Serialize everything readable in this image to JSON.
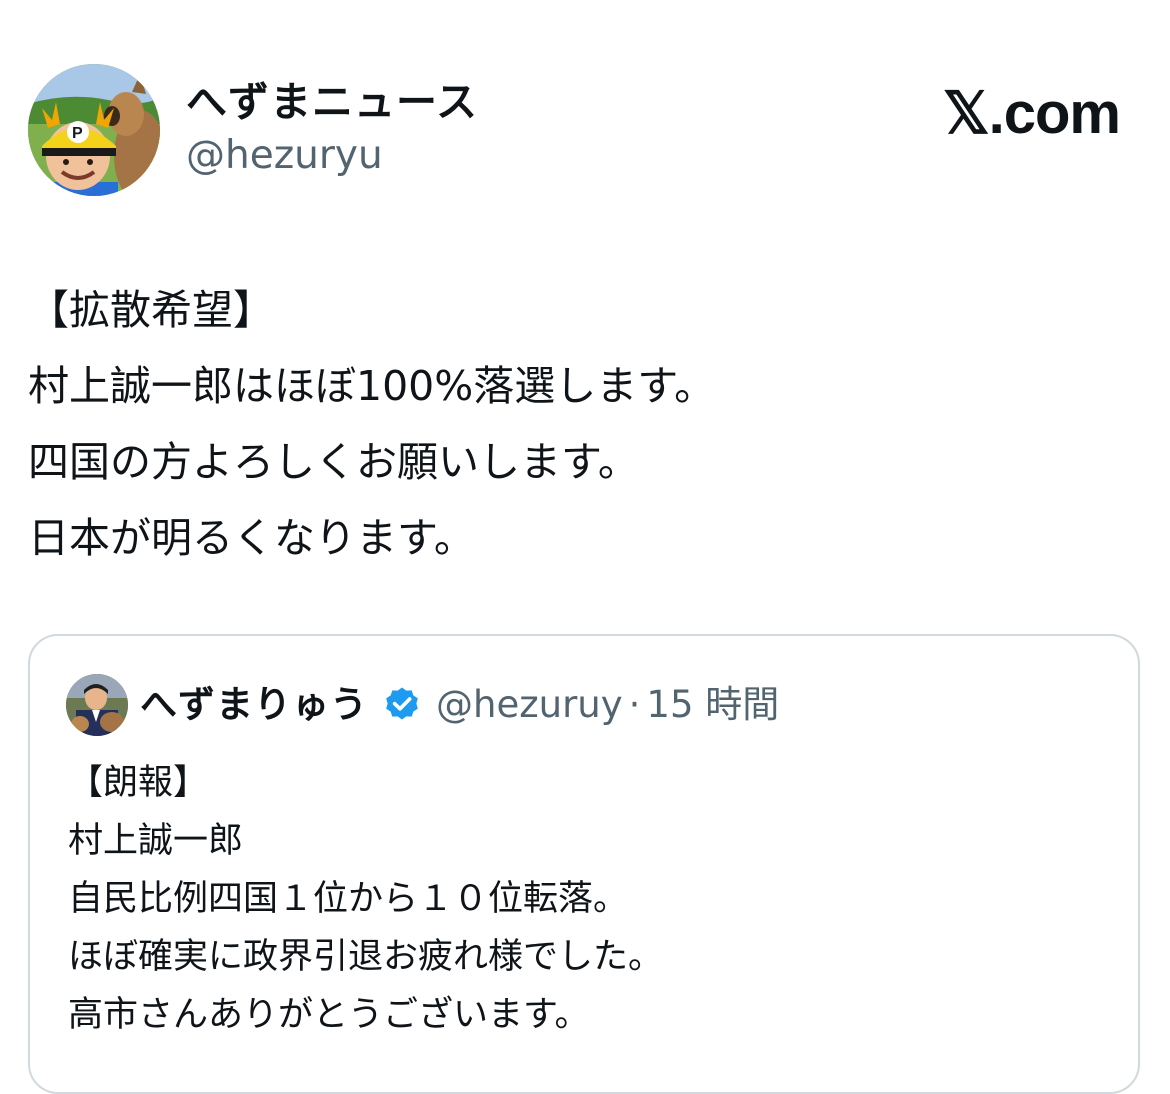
{
  "author": {
    "display_name": "へずまニュース",
    "handle": "@hezuryu"
  },
  "brand": {
    "label": "𝕏.com"
  },
  "tweet": {
    "lines": [
      "【拡散希望】",
      "村上誠一郎はほぼ100%落選します。",
      "四国の方よろしくお願いします。",
      "日本が明るくなります。"
    ]
  },
  "quote": {
    "display_name": "へずまりゅう",
    "handle": "@hezuruy",
    "separator": "·",
    "time": "15 時間",
    "verified_color": "#1d9bf0",
    "lines": [
      "【朗報】",
      "村上誠一郎",
      "自民比例四国１位から１０位転落。",
      "ほぼ確実に政界引退お疲れ様でした。",
      "高市さんありがとうございます。"
    ]
  },
  "icons": {
    "author_avatar": "avatar-with-deer",
    "quote_avatar": "avatar-with-deer-small",
    "verified": "verified-badge-icon"
  }
}
